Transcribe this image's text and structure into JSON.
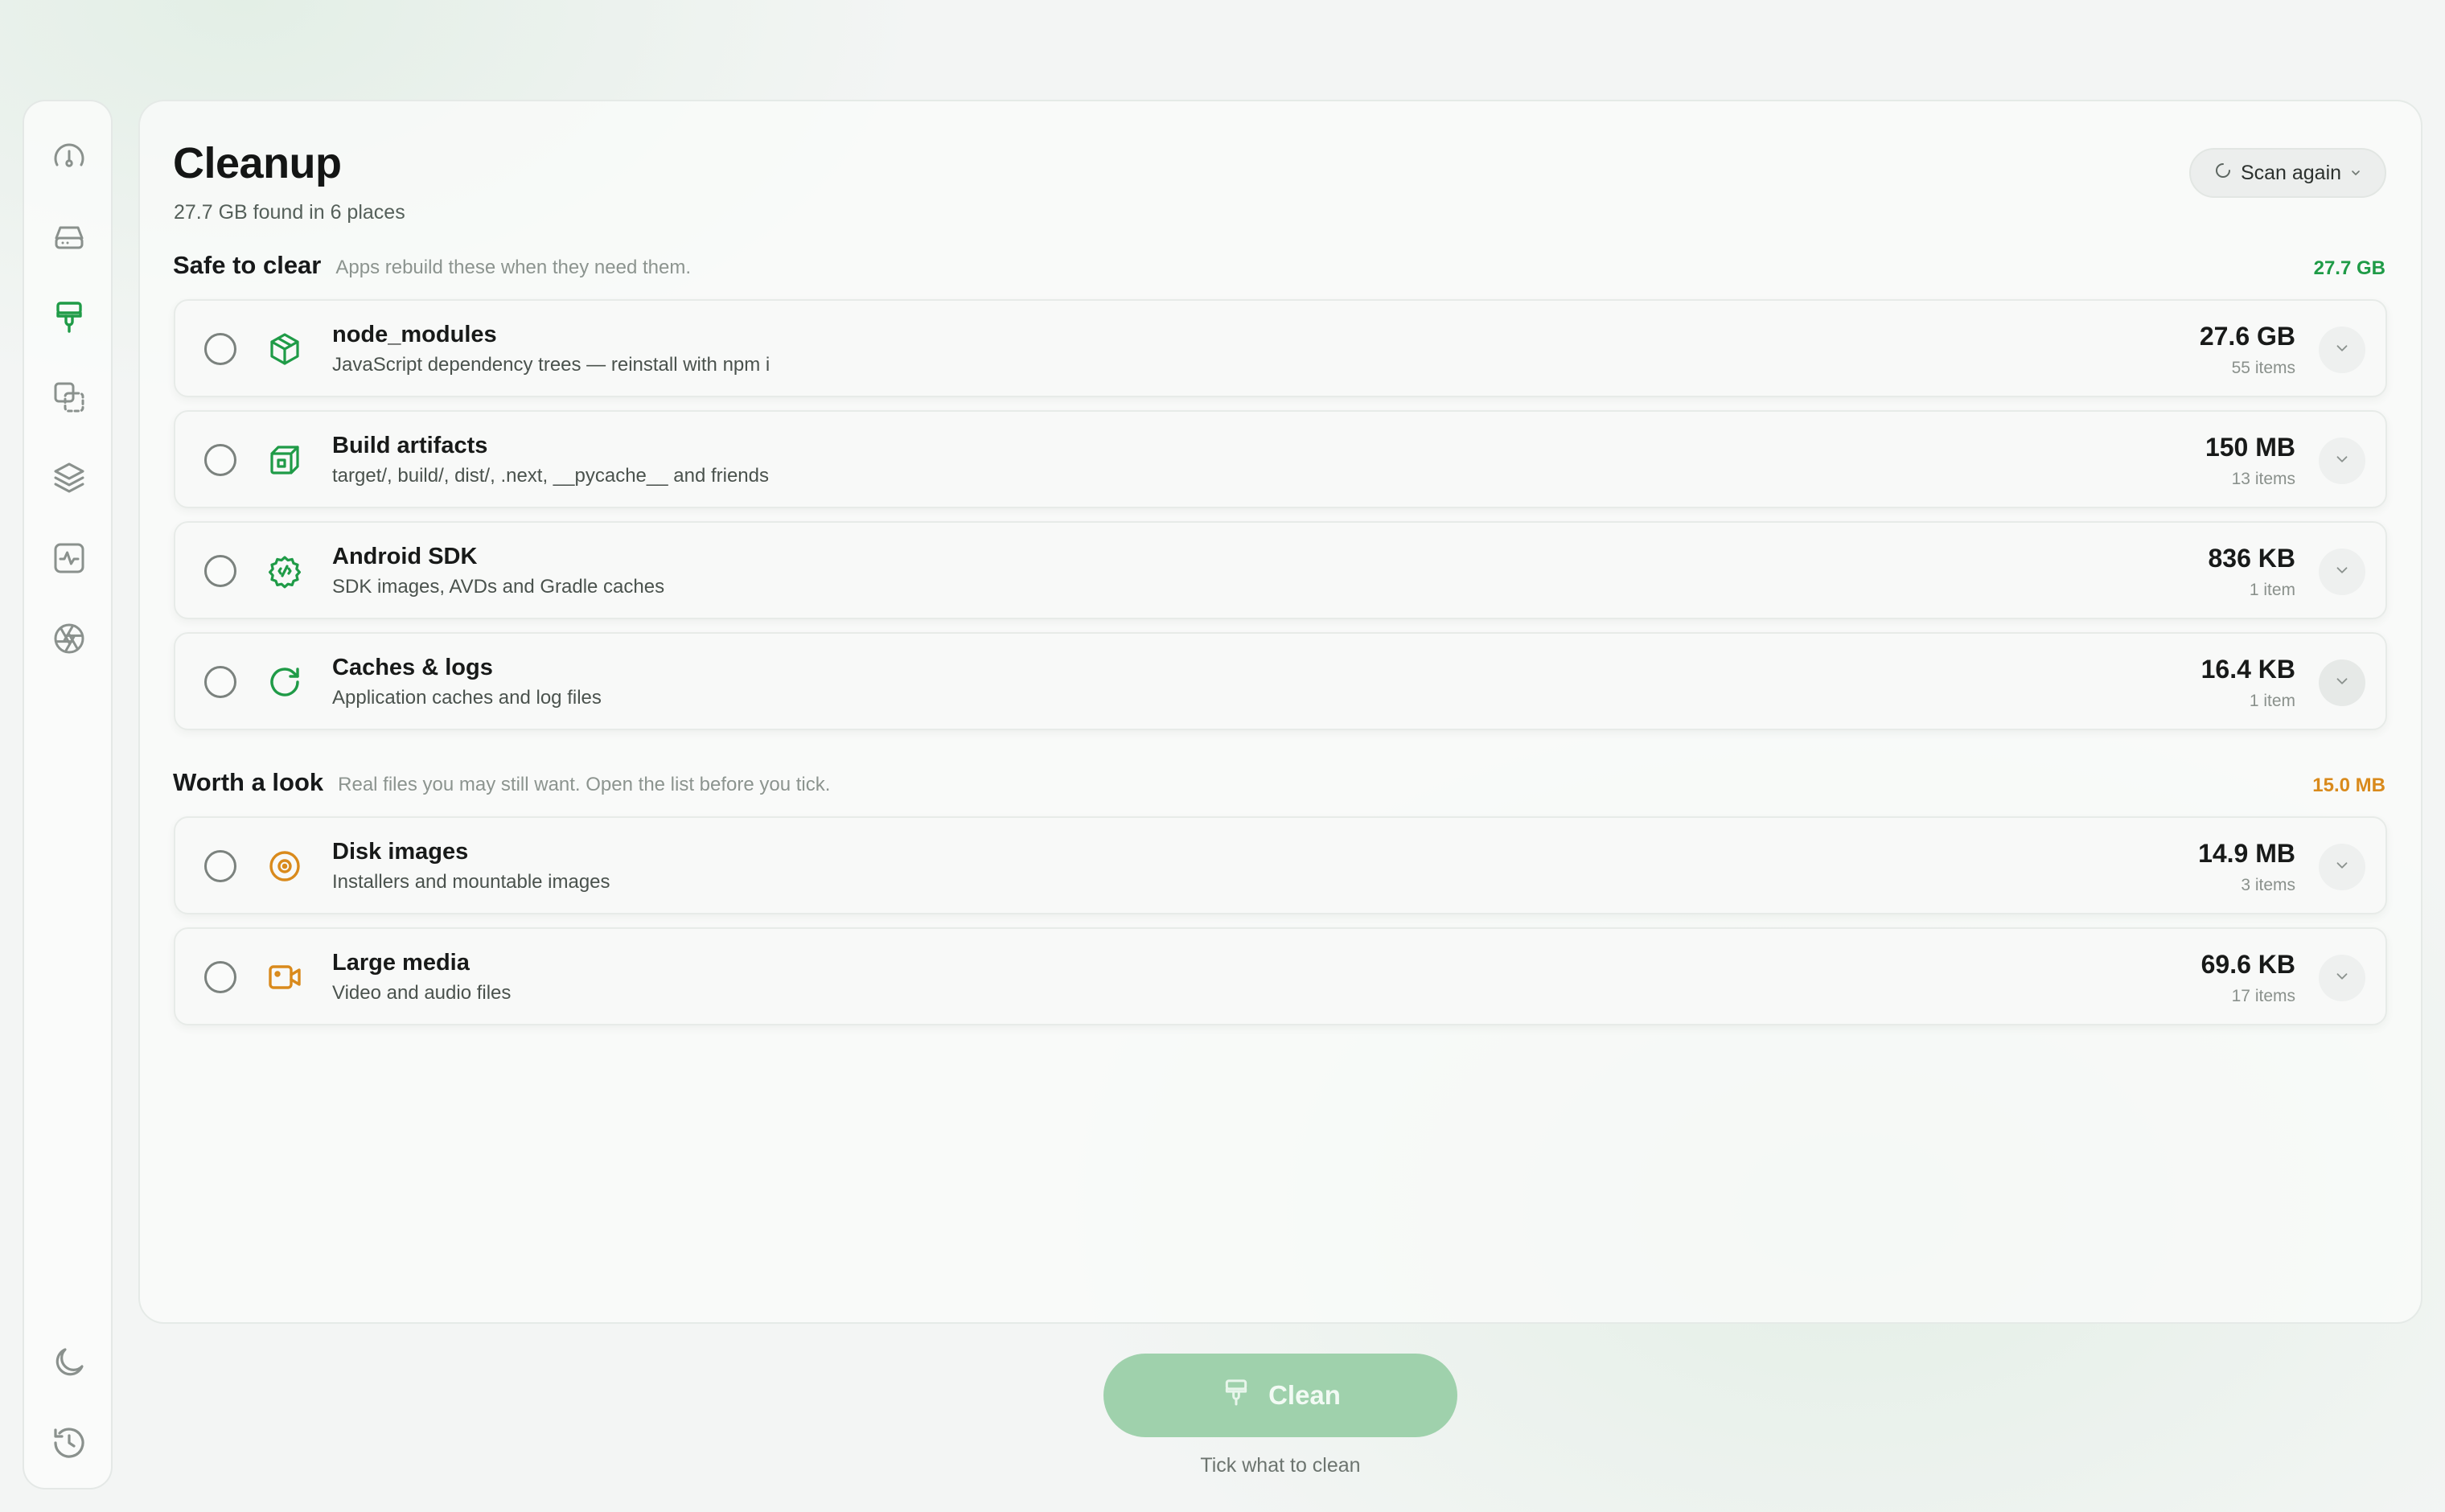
{
  "sidebar": {
    "items": [
      {
        "icon": "gauge-icon"
      },
      {
        "icon": "drive-icon"
      },
      {
        "icon": "brush-icon",
        "active": true
      },
      {
        "icon": "duplicate-icon"
      },
      {
        "icon": "layers-icon"
      },
      {
        "icon": "activity-icon"
      },
      {
        "icon": "aperture-icon"
      }
    ],
    "bottom": [
      {
        "icon": "moon-icon"
      },
      {
        "icon": "history-icon"
      }
    ]
  },
  "header": {
    "title": "Cleanup",
    "subtitle": "27.7 GB found in 6 places",
    "scan_label": "Scan again"
  },
  "sections": [
    {
      "title": "Safe to clear",
      "subtitle": "Apps rebuild these when they need them.",
      "total": "27.7 GB",
      "color": "#1f9b47",
      "items": [
        {
          "name": "node_modules",
          "desc": "JavaScript dependency trees — reinstall with npm i",
          "size": "27.6 GB",
          "count": "55 items",
          "icon": "package-icon",
          "selected": false
        },
        {
          "name": "Build artifacts",
          "desc": "target/, build/, dist/, .next, __pycache__ and friends",
          "size": "150 MB",
          "count": "13 items",
          "icon": "cube-icon",
          "selected": false
        },
        {
          "name": "Android SDK",
          "desc": "SDK images, AVDs and Gradle caches",
          "size": "836 KB",
          "count": "1 item",
          "icon": "chip-icon",
          "selected": false
        },
        {
          "name": "Caches & logs",
          "desc": "Application caches and log files",
          "size": "16.4 KB",
          "count": "1 item",
          "icon": "refresh-icon",
          "selected": false
        }
      ]
    },
    {
      "title": "Worth a look",
      "subtitle": "Real files you may still want. Open the list before you tick.",
      "total": "15.0 MB",
      "color": "#d98a1c",
      "items": [
        {
          "name": "Disk images",
          "desc": "Installers and mountable images",
          "size": "14.9 MB",
          "count": "3 items",
          "icon": "disc-icon",
          "selected": false
        },
        {
          "name": "Large media",
          "desc": "Video and audio files",
          "size": "69.6 KB",
          "count": "17 items",
          "icon": "video-icon",
          "selected": false
        }
      ]
    }
  ],
  "footer": {
    "clean_label": "Clean",
    "hint": "Tick what to clean"
  },
  "colors": {
    "accent": "#1f9b47",
    "warning": "#d98a1c",
    "clean_button": "#9fd1ac"
  }
}
